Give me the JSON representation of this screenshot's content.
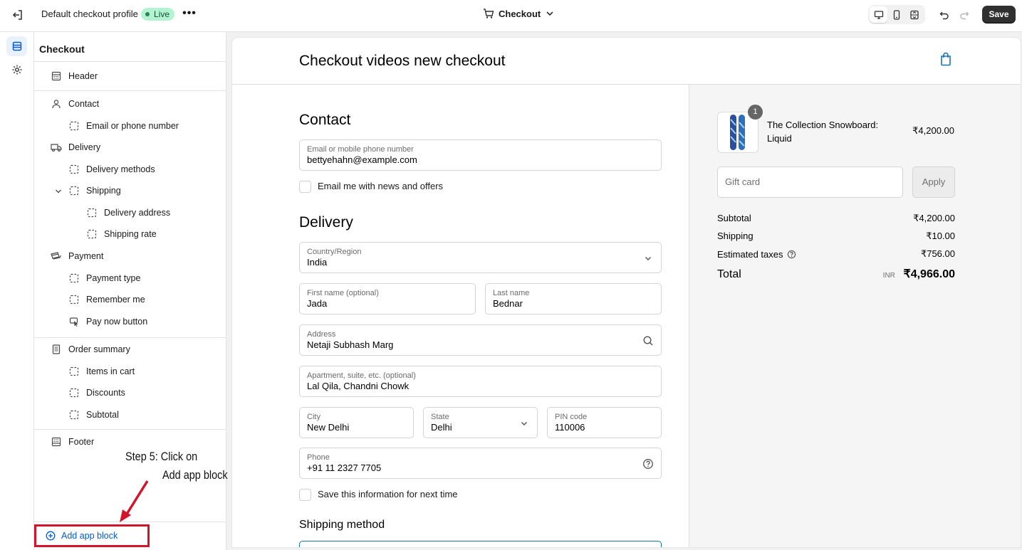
{
  "topbar": {
    "profile_title": "Default checkout profile",
    "live_badge": "Live",
    "more_label": "•••",
    "center_page": "Checkout",
    "save_label": "Save"
  },
  "sidebar": {
    "title": "Checkout",
    "items": [
      {
        "label": "Header",
        "icon": "header-icon"
      },
      {
        "label": "Contact",
        "icon": "person-icon"
      },
      {
        "label": "Email or phone number",
        "icon": "block-icon"
      },
      {
        "label": "Delivery",
        "icon": "truck-icon"
      },
      {
        "label": "Delivery methods",
        "icon": "block-icon"
      },
      {
        "label": "Shipping",
        "icon": "block-icon"
      },
      {
        "label": "Delivery address",
        "icon": "block-icon"
      },
      {
        "label": "Shipping rate",
        "icon": "block-icon"
      },
      {
        "label": "Payment",
        "icon": "payment-icon"
      },
      {
        "label": "Payment type",
        "icon": "block-icon"
      },
      {
        "label": "Remember me",
        "icon": "block-icon"
      },
      {
        "label": "Pay now button",
        "icon": "cursor-icon"
      },
      {
        "label": "Order summary",
        "icon": "receipt-icon"
      },
      {
        "label": "Items in cart",
        "icon": "block-icon"
      },
      {
        "label": "Discounts",
        "icon": "block-icon"
      },
      {
        "label": "Subtotal",
        "icon": "block-icon"
      },
      {
        "label": "Footer",
        "icon": "footer-icon"
      }
    ],
    "add_app_block": "Add app block"
  },
  "annotation": {
    "line1": "Step 5: Click on",
    "line2": "Add app block",
    "color": "#d3142a"
  },
  "preview": {
    "store_name": "Checkout videos new checkout",
    "contact": {
      "heading": "Contact",
      "email_label": "Email or mobile phone number",
      "email_value": "bettyehahn@example.com",
      "news_label": "Email me with news and offers"
    },
    "delivery": {
      "heading": "Delivery",
      "country_label": "Country/Region",
      "country_value": "India",
      "first_label": "First name (optional)",
      "first_value": "Jada",
      "last_label": "Last name",
      "last_value": "Bednar",
      "address_label": "Address",
      "address_value": "Netaji Subhash Marg",
      "apt_label": "Apartment, suite, etc. (optional)",
      "apt_value": "Lal Qila, Chandni Chowk",
      "city_label": "City",
      "city_value": "New Delhi",
      "state_label": "State",
      "state_value": "Delhi",
      "pin_label": "PIN code",
      "pin_value": "110006",
      "phone_label": "Phone",
      "phone_value": "+91 11 2327 7705",
      "save_info_label": "Save this information for next time"
    },
    "shipping_method_heading": "Shipping method",
    "summary": {
      "quantity": "1",
      "product_name": "The Collection Snowboard: Liquid",
      "product_price": "₹4,200.00",
      "gift_placeholder": "Gift card",
      "apply_label": "Apply",
      "subtotal_label": "Subtotal",
      "subtotal_value": "₹4,200.00",
      "shipping_label": "Shipping",
      "shipping_value": "₹10.00",
      "taxes_label": "Estimated taxes",
      "taxes_value": "₹756.00",
      "total_label": "Total",
      "currency": "INR",
      "total_value": "₹4,966.00"
    }
  }
}
